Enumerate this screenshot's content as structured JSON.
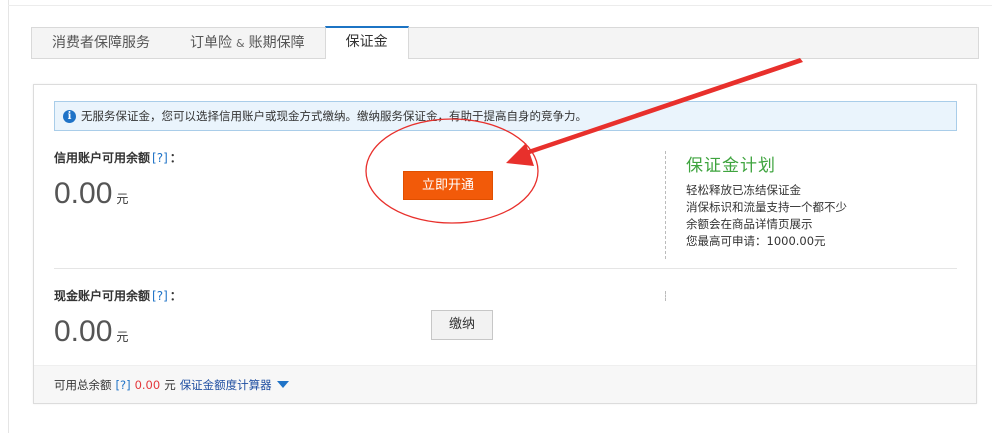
{
  "tabs": [
    {
      "label": "消费者保障服务"
    },
    {
      "label_a": "订单险",
      "amp": "&",
      "label_b": "账期保障"
    },
    {
      "label": "保证金"
    }
  ],
  "notice": {
    "icon": "info-icon",
    "text": "无服务保证金，您可以选择信用账户或现金方式缴纳。缴纳服务保证金，有助于提高自身的竞争力。"
  },
  "credit": {
    "label": "信用账户可用余额",
    "help": "[?]",
    "colon": "：",
    "amount": "0.00",
    "unit": "元",
    "button": "立即开通"
  },
  "plan": {
    "logo": "保证金计划",
    "lines": [
      "轻松释放已冻结保证金",
      "消保标识和流量支持一个都不少",
      "余额会在商品详情页展示",
      "您最高可申请：1000.00元"
    ]
  },
  "cash": {
    "label": "现金账户可用余额",
    "help": "[?]",
    "colon": "：",
    "amount": "0.00",
    "unit": "元",
    "button": "缴纳"
  },
  "footer": {
    "label": "可用总余额",
    "help": "[?]",
    "amount": "0.00",
    "unit": "元",
    "calc": "保证金额度计算器"
  },
  "colors": {
    "accent": "#1f73c7",
    "primary_button": "#f25a09",
    "annotation": "#e8302c"
  }
}
